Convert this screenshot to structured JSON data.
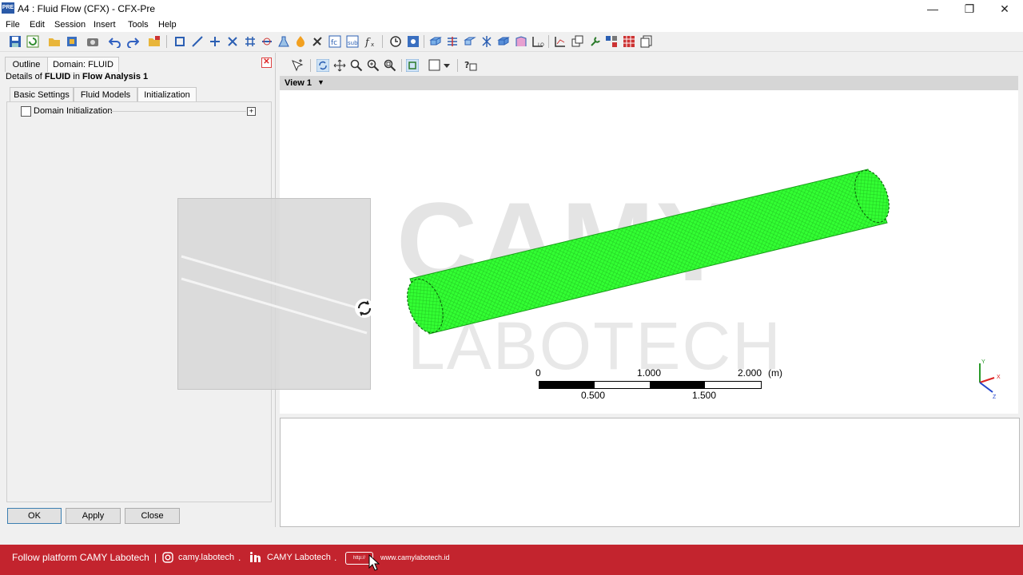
{
  "window": {
    "app_icon_text": "PRE",
    "title": "A4 : Fluid Flow (CFX) - CFX-Pre",
    "minimize": "—",
    "restore": "❐",
    "close": "✕"
  },
  "menu": [
    "File",
    "Edit",
    "Session",
    "Insert",
    "Tools",
    "Help"
  ],
  "left_panel": {
    "tabs": [
      "Outline",
      "Domain: FLUID"
    ],
    "details_prefix": "Details of ",
    "details_object": "FLUID",
    "details_mid": " in ",
    "details_analysis": "Flow Analysis 1",
    "subtabs": [
      "Basic Settings",
      "Fluid Models",
      "Initialization"
    ],
    "active_subtab": "Initialization",
    "domain_initialization_label": "Domain Initialization",
    "domain_initialization_checked": false,
    "buttons": {
      "ok": "OK",
      "apply": "Apply",
      "close": "Close"
    }
  },
  "viewer": {
    "view_title": "View 1",
    "scale": {
      "top_labels": [
        "0",
        "1.000",
        "2.000"
      ],
      "unit": "(m)",
      "bottom_labels": [
        "0.500",
        "1.500"
      ]
    },
    "watermark": {
      "line1": "CAMY",
      "line2": "LABOTECH"
    },
    "axis": {
      "x": "X",
      "y": "Y",
      "z": "Z"
    },
    "mesh_color": "#33ff33"
  },
  "footer": {
    "follow_text": "Follow platform CAMY Labotech",
    "separator": "|",
    "instagram": "camy.labotech",
    "linkedin": "CAMY Labotech",
    "http_badge": "http://",
    "website": "www.camylabotech.id",
    "dots": "."
  },
  "colors": {
    "footer_bg": "#c3242e",
    "mesh": "#33ff33",
    "close_red": "#d22222"
  }
}
